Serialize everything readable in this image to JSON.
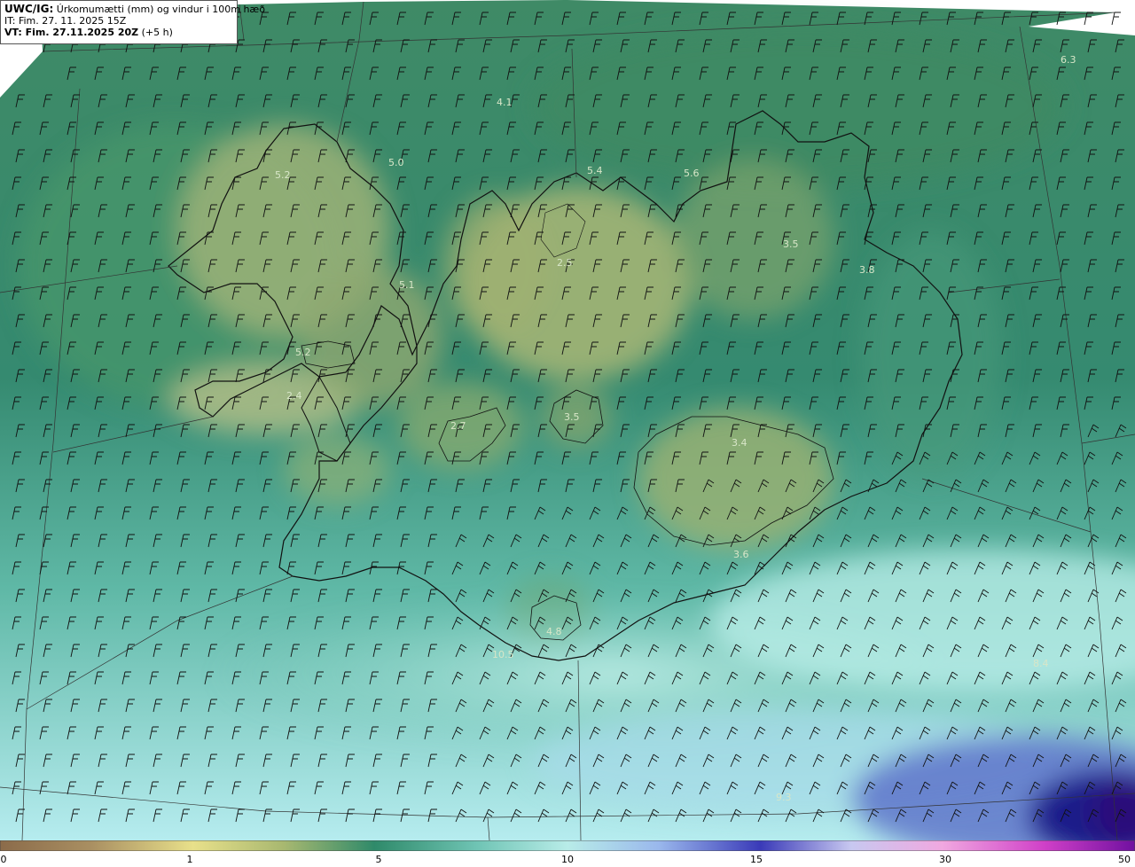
{
  "header": {
    "code": "UWC/IG:",
    "description": "Úrkomumætti (mm) og vindur i 100m hæð",
    "init_time": "IT: Fim. 27. 11. 2025 15Z",
    "valid_time_bold": "VT: Fim. 27.11.2025 20Z",
    "valid_time_suffix": "(+5 h)"
  },
  "map": {
    "region": "Iceland",
    "variable": "precipitable water (mm)",
    "wind_level": "100m",
    "values": [
      {
        "id": "v1",
        "text": "6.3"
      },
      {
        "id": "v2",
        "text": "4.1"
      },
      {
        "id": "v3",
        "text": "5.0"
      },
      {
        "id": "v4",
        "text": "5.2"
      },
      {
        "id": "v5",
        "text": "5.4"
      },
      {
        "id": "v6",
        "text": "5.6"
      },
      {
        "id": "v7",
        "text": "3.5"
      },
      {
        "id": "v8",
        "text": "3.8"
      },
      {
        "id": "v9",
        "text": "5.1"
      },
      {
        "id": "v10",
        "text": "2.5"
      },
      {
        "id": "v11",
        "text": "5.2"
      },
      {
        "id": "v12",
        "text": "2.4"
      },
      {
        "id": "v13",
        "text": "2.7"
      },
      {
        "id": "v14",
        "text": "3.5"
      },
      {
        "id": "v15",
        "text": "3.4"
      },
      {
        "id": "v16",
        "text": "3.6"
      },
      {
        "id": "v17",
        "text": "4.8"
      },
      {
        "id": "v18",
        "text": "10.5"
      },
      {
        "id": "v19",
        "text": "8.4"
      },
      {
        "id": "v20",
        "text": "9.3"
      }
    ]
  },
  "colorbar": {
    "ticks": [
      "0",
      "1",
      "5",
      "10",
      "15",
      "30",
      "50"
    ],
    "colors": {
      "low": "#8b6b4a",
      "tan": "#c9b47a",
      "yellow": "#e8e08a",
      "green": "#2f8a6a",
      "aqua": "#b8ece8",
      "blue": "#3a3ab8",
      "navy": "#20107a",
      "pink": "#f0a8e0",
      "magenta": "#d040c8",
      "purple": "#7010a0"
    }
  }
}
